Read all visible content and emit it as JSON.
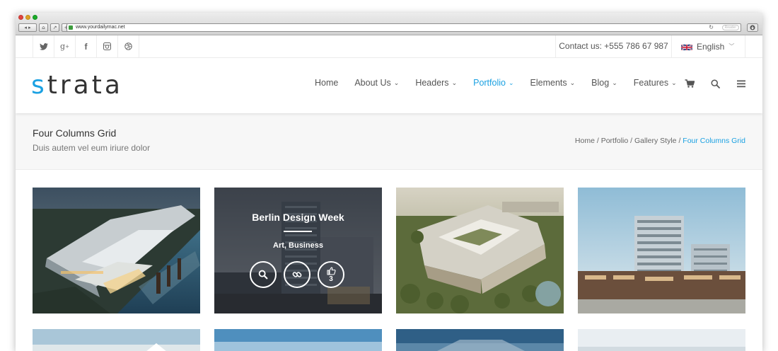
{
  "browser": {
    "url": "www.yourdailymac.net",
    "reader_label": "Reader"
  },
  "topbar": {
    "social_icons": [
      "twitter-icon",
      "google-plus-icon",
      "facebook-icon",
      "instagram-icon",
      "dribbble-icon"
    ],
    "contact": "Contact us: +555 786 67 987",
    "language": "English"
  },
  "header": {
    "logo_first": "s",
    "logo_rest": "trata",
    "nav": [
      {
        "label": "Home",
        "dropdown": false,
        "active": false
      },
      {
        "label": "About Us",
        "dropdown": true,
        "active": false
      },
      {
        "label": "Headers",
        "dropdown": true,
        "active": false
      },
      {
        "label": "Portfolio",
        "dropdown": true,
        "active": true
      },
      {
        "label": "Elements",
        "dropdown": true,
        "active": false
      },
      {
        "label": "Blog",
        "dropdown": true,
        "active": false
      },
      {
        "label": "Features",
        "dropdown": true,
        "active": false
      }
    ]
  },
  "page": {
    "title": "Four Columns Grid",
    "subtitle": "Duis autem vel eum iriure dolor",
    "breadcrumb": [
      "Home",
      "Portfolio",
      "Gallery Style",
      "Four Columns Grid"
    ]
  },
  "portfolio": {
    "hover_item": {
      "title": "Berlin Design Week",
      "categories": "Art, Business",
      "likes": "3"
    }
  },
  "colors": {
    "accent": "#1ba1e2"
  }
}
